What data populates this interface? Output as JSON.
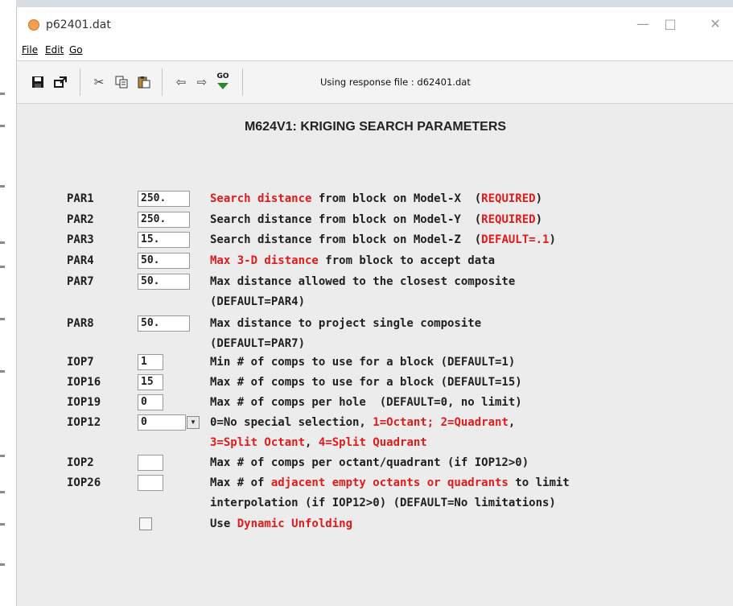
{
  "window": {
    "title": "p62401.dat",
    "min_glyph": "—",
    "max_glyph": "□",
    "close_glyph": "✕"
  },
  "menubar": {
    "file": "File",
    "edit": "Edit",
    "go": "Go"
  },
  "toolbar": {
    "go_label": "GO",
    "response_text": "Using response file : d62401.dat"
  },
  "form": {
    "heading": "M624V1: KRIGING SEARCH PARAMETERS",
    "rows": [
      {
        "name": "PAR1",
        "value": "250.",
        "desc_parts": [
          {
            "t": "Search distance",
            "red": true
          },
          {
            "t": " from block on Model-X  (",
            "red": false
          },
          {
            "t": "REQUIRED",
            "red": true
          },
          {
            "t": ")",
            "red": false
          }
        ]
      },
      {
        "name": "PAR2",
        "value": "250.",
        "desc_parts": [
          {
            "t": "Search distance from block on Model-Y  (",
            "red": false
          },
          {
            "t": "REQUIRED",
            "red": true
          },
          {
            "t": ")",
            "red": false
          }
        ]
      },
      {
        "name": "PAR3",
        "value": "15.",
        "desc_parts": [
          {
            "t": "Search distance from block on Model-Z  (",
            "red": false
          },
          {
            "t": "DEFAULT=.1",
            "red": true
          },
          {
            "t": ")",
            "red": false
          }
        ]
      },
      {
        "name": "PAR4",
        "value": "50.",
        "desc_parts": [
          {
            "t": "Max 3-D distance",
            "red": true
          },
          {
            "t": " from block to accept data",
            "red": false
          }
        ]
      },
      {
        "name": "PAR7",
        "value": "50.",
        "desc_parts": [
          {
            "t": "Max distance allowed to the closest composite",
            "red": false
          }
        ],
        "desc2": "(DEFAULT=PAR4)"
      },
      {
        "name": "PAR8",
        "value": "50.",
        "desc_parts": [
          {
            "t": "Max distance to project single composite",
            "red": false
          }
        ],
        "desc2": "(DEFAULT=PAR7)"
      },
      {
        "name": "IOP7",
        "value": "1",
        "desc_parts": [
          {
            "t": "Min # of comps to use for a block (DEFAULT=1)",
            "red": false
          }
        ]
      },
      {
        "name": "IOP16",
        "value": "15",
        "desc_parts": [
          {
            "t": "Max # of comps to use for a block (DEFAULT=15)",
            "red": false
          }
        ]
      },
      {
        "name": "IOP19",
        "value": "0",
        "desc_parts": [
          {
            "t": "Max # of comps per hole  (DEFAULT=0, no limit)",
            "red": false
          }
        ]
      },
      {
        "name": "IOP12",
        "value": "0",
        "desc_parts": [
          {
            "t": "0=No special selection, ",
            "red": false
          },
          {
            "t": "1=Octant; 2=Quadrant",
            "red": true
          },
          {
            "t": ",",
            "red": false
          }
        ],
        "desc2_parts": [
          {
            "t": "3=Split Octant",
            "red": true
          },
          {
            "t": ", ",
            "red": false
          },
          {
            "t": "4=Split Quadrant",
            "red": true
          }
        ]
      },
      {
        "name": "IOP2",
        "value": "",
        "desc_parts": [
          {
            "t": "Max # of comps per octant/quadrant (if IOP12>0)",
            "red": false
          }
        ]
      },
      {
        "name": "IOP26",
        "value": "",
        "desc_parts": [
          {
            "t": "Max # of ",
            "red": false
          },
          {
            "t": "adjacent empty octants or quadrants",
            "red": true
          },
          {
            "t": " to limit",
            "red": false
          }
        ],
        "desc2": "interpolation (if IOP12>0) (DEFAULT=No limitations)"
      }
    ],
    "checkbox": {
      "checked": false,
      "label_parts": [
        {
          "t": "Use ",
          "red": false
        },
        {
          "t": "Dynamic Unfolding",
          "red": true
        }
      ]
    }
  },
  "colors": {
    "accent_red": "#e01b1b",
    "text": "#202020"
  }
}
